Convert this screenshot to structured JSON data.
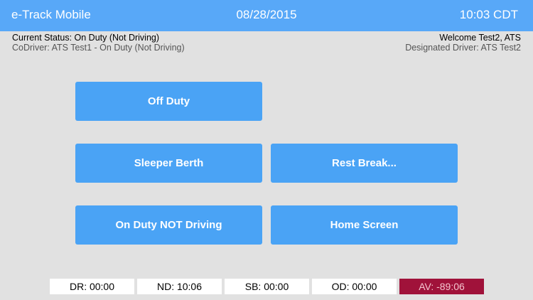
{
  "header": {
    "app_title": "e-Track Mobile",
    "date": "08/28/2015",
    "time": "10:03 CDT"
  },
  "status": {
    "current_status": "Current Status: On Duty (Not Driving)",
    "codriver": "CoDriver: ATS Test1 - On Duty (Not Driving)",
    "welcome": "Welcome Test2, ATS",
    "designated_driver": "Designated Driver: ATS Test2"
  },
  "buttons": {
    "off_duty": "Off Duty",
    "sleeper_berth": "Sleeper Berth",
    "rest_break": "Rest Break...",
    "on_duty_not_driving": "On Duty NOT Driving",
    "home_screen": "Home Screen"
  },
  "counters": {
    "dr": "DR: 00:00",
    "nd": "ND: 10:06",
    "sb": "SB: 00:00",
    "od": "OD: 00:00",
    "av": "AV: -89:06"
  },
  "colors": {
    "header_bg": "#58a8f8",
    "button_bg": "#4aa3f5",
    "background": "#e1e1e1",
    "av_alert_bg": "#a0123a"
  }
}
